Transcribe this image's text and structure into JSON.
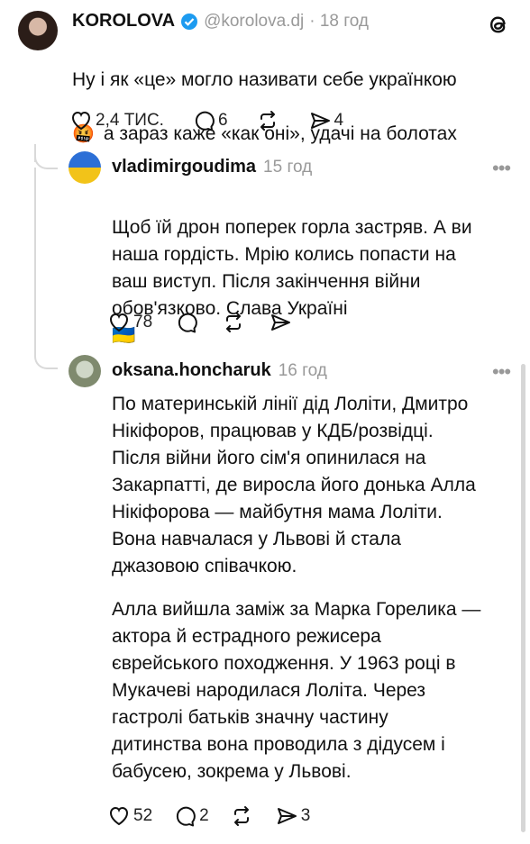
{
  "main_post": {
    "author": "KOROLOVA",
    "handle": "@korolova.dj",
    "time": "· 18 год",
    "text_line1": "Ну і як «це» могло називати себе українкою",
    "text_line2": "а зараз каже «как оні», удачі на болотах",
    "likes": "2,4 ТИС.",
    "comments": "6",
    "shares": "4",
    "emoji": "🤬",
    "verified_color": "#1d9bf0"
  },
  "replies": [
    {
      "author": "vladimirgoudima",
      "time": "15 год",
      "text": "Щоб їй дрон поперек горла застряв. А ви\nнаша гордість. Мрію колись попасти на\nваш виступ. Після закінчення війни\nобов'язково. Слава Україні",
      "flag": "🇺🇦",
      "likes": "78"
    },
    {
      "author": "oksana.honcharuk",
      "time": "16 год",
      "para1": "По материнській лінії дід Лоліти, Дмитро\nНікіфоров, працював у КДБ/розвідці.\nПісля війни його сім'я опинилася на\nЗакарпатті, де виросла його донька Алла\nНікіфорова — майбутня мама Лоліти.\nВона навчалася у Львові й стала\nджазовою співачкою.",
      "para2": "Алла вийшла заміж за Марка Горелика —\nактора й естрадного режисера\nєврейського походження. У 1963 році в\nМукачеві народилася Лоліта. Через\nгастролі батьків значну частину\nдитинства вона проводила з дідусем і\nбабусею, зокрема у Львові.",
      "likes": "52",
      "comments": "2",
      "shares": "3"
    }
  ]
}
